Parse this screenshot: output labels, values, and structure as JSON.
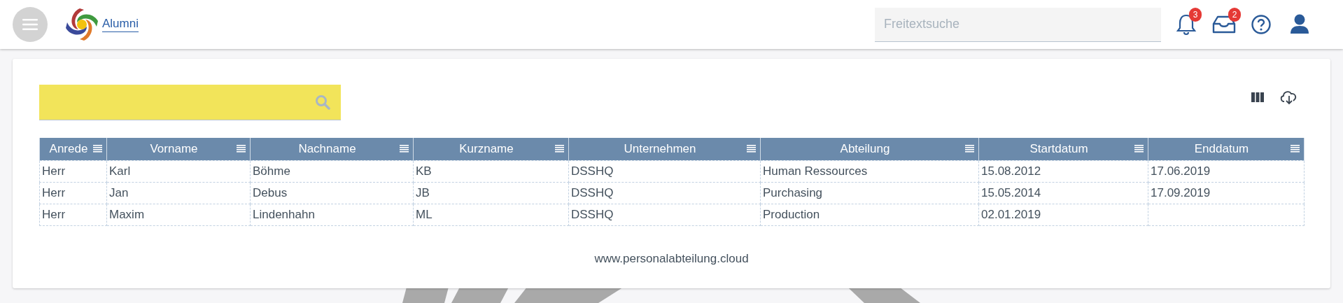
{
  "header": {
    "app_name": "Alumni",
    "search": {
      "placeholder": "Freitextsuche"
    },
    "notifications": {
      "count": "3"
    },
    "inbox": {
      "count": "2"
    }
  },
  "table": {
    "columns": [
      {
        "label": "Anrede"
      },
      {
        "label": "Vorname"
      },
      {
        "label": "Nachname"
      },
      {
        "label": "Kurzname"
      },
      {
        "label": "Unternehmen"
      },
      {
        "label": "Abteilung"
      },
      {
        "label": "Startdatum"
      },
      {
        "label": "Enddatum"
      }
    ],
    "rows": [
      [
        "Herr",
        "Karl",
        "Böhme",
        "KB",
        "DSSHQ",
        "Human Ressources",
        "15.08.2012",
        "17.06.2019"
      ],
      [
        "Herr",
        "Jan",
        "Debus",
        "JB",
        "DSSHQ",
        "Purchasing",
        "15.05.2014",
        "17.09.2019"
      ],
      [
        "Herr",
        "Maxim",
        "Lindenhahn",
        "ML",
        "DSSHQ",
        "Production",
        "02.01.2019",
        ""
      ]
    ]
  },
  "footer": "www.personalabteilung.cloud"
}
